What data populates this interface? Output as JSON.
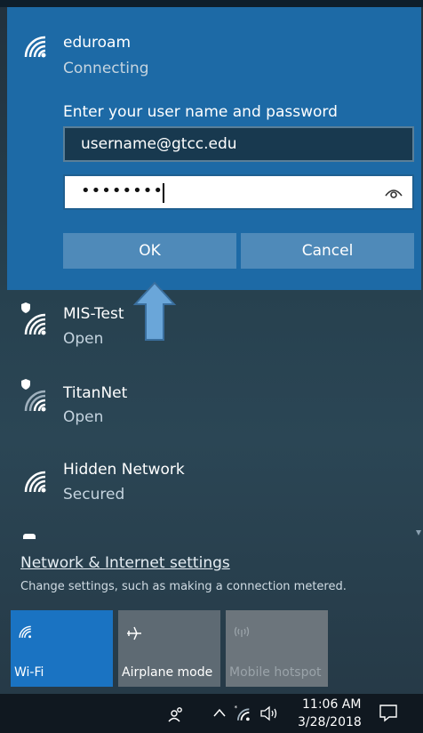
{
  "selected_network": {
    "name": "eduroam",
    "status": "Connecting",
    "prompt": "Enter your user name and password",
    "username_value": "username@gtcc.edu",
    "password_mask": "••••••••",
    "ok_label": "OK",
    "cancel_label": "Cancel"
  },
  "networks": [
    {
      "name": "MIS-Test",
      "status": "Open"
    },
    {
      "name": "TitanNet",
      "status": "Open"
    },
    {
      "name": "Hidden Network",
      "status": "Secured"
    }
  ],
  "settings": {
    "link": "Network & Internet settings",
    "description": "Change settings, such as making a connection metered."
  },
  "quick_actions": [
    {
      "label": "Wi-Fi",
      "icon": "wifi-icon",
      "state": "on"
    },
    {
      "label": "Airplane mode",
      "icon": "airplane-icon",
      "state": "off"
    },
    {
      "label": "Mobile hotspot",
      "icon": "hotspot-icon",
      "state": "disabled"
    }
  ],
  "taskbar": {
    "time": "11:06 AM",
    "date": "3/28/2018"
  },
  "colors": {
    "accent": "#1d6aa6",
    "button": "#4f8ab9",
    "tile_active": "#1a73c2"
  }
}
